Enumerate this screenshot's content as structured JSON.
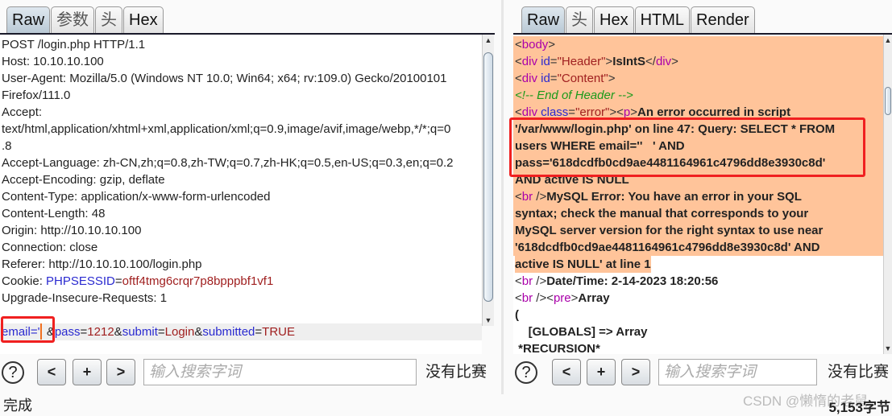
{
  "request": {
    "tabs": [
      "Raw",
      "参数",
      "头",
      "Hex"
    ],
    "active_tab": "Raw",
    "lines": [
      [
        {
          "t": "POST /login.php HTTP/1.1"
        }
      ],
      [
        {
          "t": "Host: 10.10.10.100"
        }
      ],
      [
        {
          "t": "User-Agent: Mozilla/5.0 (Windows NT 10.0; Win64; x64; rv:109.0) Gecko/20100101"
        }
      ],
      [
        {
          "t": "Firefox/111.0"
        }
      ],
      [
        {
          "t": "Accept:"
        }
      ],
      [
        {
          "t": "text/html,application/xhtml+xml,application/xml;q=0.9,image/avif,image/webp,*/*;q=0"
        }
      ],
      [
        {
          "t": ".8"
        }
      ],
      [
        {
          "t": "Accept-Language: zh-CN,zh;q=0.8,zh-TW;q=0.7,zh-HK;q=0.5,en-US;q=0.3,en;q=0.2"
        }
      ],
      [
        {
          "t": "Accept-Encoding: gzip, deflate"
        }
      ],
      [
        {
          "t": "Content-Type: application/x-www-form-urlencoded"
        }
      ],
      [
        {
          "t": "Content-Length: 48"
        }
      ],
      [
        {
          "t": "Origin: http://10.10.10.100"
        }
      ],
      [
        {
          "t": "Connection: close"
        }
      ],
      [
        {
          "t": "Referer: http://10.10.10.100/login.php"
        }
      ],
      [
        {
          "t": "Cookie: "
        },
        {
          "t": "PHPSESSID",
          "c": "pk"
        },
        {
          "t": "="
        },
        {
          "t": "oftf4tmg6crqr7p8bpppbf1vf1",
          "c": "pv"
        }
      ],
      [
        {
          "t": "Upgrade-Insecure-Requests: 1"
        }
      ],
      [
        {
          "t": ""
        }
      ],
      [
        {
          "t": "email",
          "c": "pk"
        },
        {
          "t": "='  ",
          "c": "pk"
        },
        {
          "t": "&"
        },
        {
          "t": "pass",
          "c": "pk"
        },
        {
          "t": "="
        },
        {
          "t": "1212",
          "c": "pv"
        },
        {
          "t": "&"
        },
        {
          "t": "submit",
          "c": "pk"
        },
        {
          "t": "="
        },
        {
          "t": "Login",
          "c": "pv"
        },
        {
          "t": "&"
        },
        {
          "t": "submitted",
          "c": "pk"
        },
        {
          "t": "="
        },
        {
          "t": "TRUE",
          "c": "pv"
        }
      ]
    ],
    "search_placeholder": "输入搜索字词",
    "no_match": "没有比赛"
  },
  "response": {
    "tabs": [
      "Raw",
      "头",
      "Hex",
      "HTML",
      "Render"
    ],
    "active_tab": "Raw",
    "lines": [
      [
        {
          "t": "<",
          "c": "pun"
        },
        {
          "t": "body",
          "c": "tag"
        },
        {
          "t": ">",
          "c": "pun"
        }
      ],
      [
        {
          "t": "<",
          "c": "pun"
        },
        {
          "t": "div",
          "c": "tag"
        },
        {
          "t": " id",
          "c": "an"
        },
        {
          "t": "=",
          "c": "pun"
        },
        {
          "t": "\"Header\"",
          "c": "val"
        },
        {
          "t": ">",
          "c": "pun"
        },
        {
          "t": "IsIntS"
        },
        {
          "t": "</",
          "c": "pun"
        },
        {
          "t": "div",
          "c": "tag"
        },
        {
          "t": ">",
          "c": "pun"
        }
      ],
      [
        {
          "t": "<",
          "c": "pun"
        },
        {
          "t": "div",
          "c": "tag"
        },
        {
          "t": " id",
          "c": "an"
        },
        {
          "t": "=",
          "c": "pun"
        },
        {
          "t": "\"Content\"",
          "c": "val"
        },
        {
          "t": ">",
          "c": "pun"
        }
      ],
      [
        {
          "t": "<!-- End of Header -->",
          "c": "cmt"
        }
      ],
      [
        {
          "t": "<",
          "c": "pun"
        },
        {
          "t": "div",
          "c": "tag"
        },
        {
          "t": " class",
          "c": "an"
        },
        {
          "t": "=",
          "c": "pun"
        },
        {
          "t": "\"error\"",
          "c": "val"
        },
        {
          "t": "><",
          "c": "pun"
        },
        {
          "t": "p",
          "c": "tag"
        },
        {
          "t": ">",
          "c": "pun"
        },
        {
          "t": "An error occurred in script"
        }
      ],
      [
        {
          "t": "'/var/www/login.php' on line 47: Query: SELECT * FROM"
        }
      ],
      [
        {
          "t": "users WHERE email=''   ' AND"
        }
      ],
      [
        {
          "t": "pass='618dcdfb0cd9ae4481164961c4796dd8e3930c8d'"
        }
      ],
      [
        {
          "t": "AND active IS NULL"
        }
      ],
      [
        {
          "t": "<",
          "c": "pun"
        },
        {
          "t": "br",
          "c": "tag"
        },
        {
          "t": " />",
          "c": "pun"
        },
        {
          "t": "MySQL Error: You have an error in your SQL"
        }
      ],
      [
        {
          "t": "syntax; check the manual that corresponds to your"
        }
      ],
      [
        {
          "t": "MySQL server version for the right syntax to use near"
        }
      ],
      [
        {
          "t": "'618dcdfb0cd9ae4481164961c4796dd8e3930c8d' AND"
        }
      ],
      [
        {
          "t": "active IS NULL' at line 1"
        }
      ],
      [
        {
          "t": "<",
          "c": "pun"
        },
        {
          "t": "br",
          "c": "tag"
        },
        {
          "t": " />",
          "c": "pun"
        },
        {
          "t": "Date/Time: 2-14-2023 18:20:56"
        }
      ],
      [
        {
          "t": "<",
          "c": "pun"
        },
        {
          "t": "br",
          "c": "tag"
        },
        {
          "t": " /><",
          "c": "pun"
        },
        {
          "t": "pre",
          "c": "tag"
        },
        {
          "t": ">",
          "c": "pun"
        },
        {
          "t": "Array"
        }
      ],
      [
        {
          "t": "("
        }
      ],
      [
        {
          "t": "    [GLOBALS] => Array"
        }
      ],
      [
        {
          "t": " *RECURSION*"
        }
      ]
    ],
    "search_placeholder": "输入搜索字词",
    "no_match": "没有比赛",
    "byte_count": "5,153字节"
  },
  "nav": {
    "help": "?",
    "prev": "<",
    "add": "+",
    "next": ">"
  },
  "status": "完成",
  "watermark": "CSDN @懒惰的老鼠",
  "colors": {
    "highlight": "#ffc49a",
    "annotation_box": "#f02020"
  }
}
